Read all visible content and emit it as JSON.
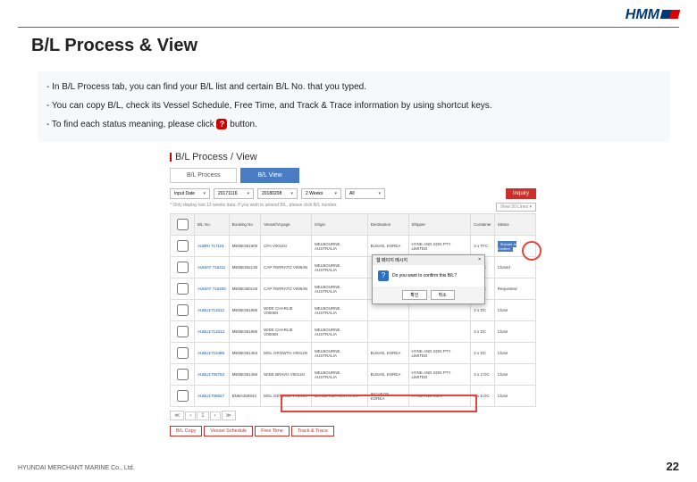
{
  "brand": "HMM",
  "title": "B/L Process & View",
  "bullets": {
    "b1": "-  In B/L Process tab, you can find your B/L list and certain B/L No. that you typed.",
    "b2": "-  You can copy B/L, check its Vessel Schedule, Free Time, and Track & Trace information by using shortcut keys.",
    "b3a": "-  To find each status meaning, please click ",
    "b3b": " button."
  },
  "shot": {
    "heading": "B/L Process / View",
    "tabs": {
      "t1": "B/L Process",
      "t2": "B/L View"
    },
    "filters": {
      "f1": "Input Date",
      "f2": "20171116",
      "f3": "20180208",
      "f4": "2 Weeks",
      "f5": "All"
    },
    "inquiry": "Inquiry",
    "note": "* Only display last 12 weeks data. If you wish to amend B/L, please click B/L number.",
    "view20": "View 20 Lines ▾",
    "headers": {
      "h1": "B/L No.",
      "h2": "Booking No",
      "h3": "Vessel/Voyage",
      "h4": "Origin",
      "h5": "Destination",
      "h6": "Shipper",
      "h7": "Container",
      "h8": "Status"
    },
    "rows": [
      {
        "bl": "AUBRI 717101",
        "bk": "MEME361900",
        "vs": "CFA V0011N",
        "or": "MELBOURNE, AUSTRALIA",
        "de": "BUSAN, KOREA",
        "sh": "HYNE AND SON PTY LIMITED",
        "ct": "3 x TFC",
        "st": "Shipper to Confirm",
        "cls": "status"
      },
      {
        "bl": "AUMAT 716211",
        "bk": "MEME362135",
        "vs": "CAP FERRATO V0054N",
        "or": "MELBOURNE, AUSTRALIA",
        "de": "",
        "sh": "",
        "ct": "2 x DC",
        "st": "Closed"
      },
      {
        "bl": "AUMAT 716200",
        "bk": "MEME360126",
        "vs": "CAP FERRATO V0054N",
        "or": "MELBOURNE, AUSTRALIA",
        "de": "",
        "sh": "",
        "ct": "4 x DC",
        "st": "Requested"
      },
      {
        "bl": "AUBU1713312",
        "bk": "MEME361895",
        "vs": "WIDE CHARLIE V0006N",
        "or": "MELBOURNE, AUSTRALIA",
        "de": "",
        "sh": "",
        "ct": "2 x DC",
        "st": "Close"
      },
      {
        "bl": "AUBU1713313",
        "bk": "MEME361895",
        "vs": "WIDE CHARLIE V0006N",
        "or": "MELBOURNE, AUSTRALIA",
        "de": "",
        "sh": "",
        "ct": "4 x DC",
        "st": "Close"
      },
      {
        "bl": "AUBU1710489",
        "bk": "MEME361463",
        "vs": "MOL GROWTH V0012N",
        "or": "MELBOURNE, AUSTRALIA",
        "de": "BUSAN, KOREA",
        "sh": "HYNE AND SON PTY LIMITED",
        "ct": "2 x DC",
        "st": "Close"
      },
      {
        "bl": "AUBU1706753",
        "bk": "MEME361466",
        "vs": "WIDE BRAVO V0011N",
        "or": "MELBOURNE, AUSTRALIA",
        "de": "BUSAN, KOREA",
        "sh": "HYNE AND SON PTY LIMITED",
        "ct": "4 x 2 DC",
        "st": "Close"
      },
      {
        "bl": "AUBU1706827",
        "bk": "BNBA358943",
        "vs": "MOL GENESIS V7504N",
        "or": "BRISBANE, AUSTRALIA",
        "de": "INCHEON, KOREA",
        "sh": "HYNE AND SON",
        "ct": "4 x 5 DC",
        "st": "Close"
      }
    ],
    "pager": {
      "p1": "≪",
      "p2": "‹",
      "p3": "1",
      "p4": "›",
      "p5": "≫"
    },
    "links": {
      "l1": "B/L Copy",
      "l2": "Vessel Schedule",
      "l3": "Free Time",
      "l4": "Track & Trace"
    }
  },
  "dialog": {
    "title": "웹 페이지 메시지",
    "msg": "Do you want to confirm this B/L?",
    "ok": "확인",
    "cancel": "취소"
  },
  "footer": "HYUNDAI MERCHANT MARINE Co., Ltd.",
  "pagenum": "22"
}
